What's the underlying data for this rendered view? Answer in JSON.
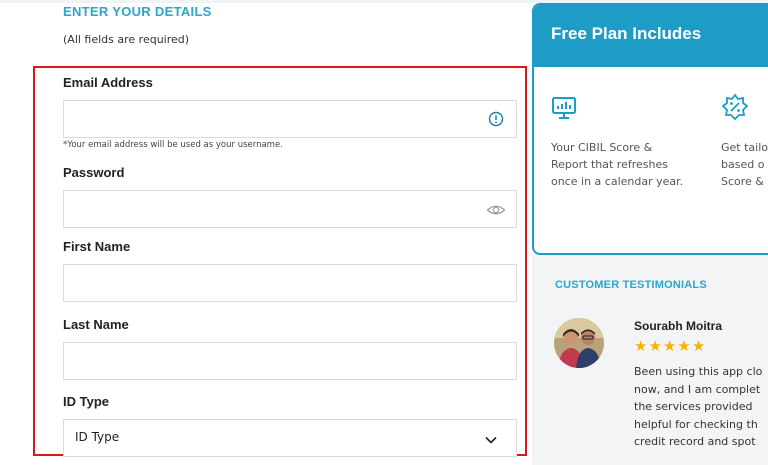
{
  "form": {
    "heading": "ENTER YOUR DETAILS",
    "subheading": "(All fields are required)",
    "email": {
      "label": "Email Address",
      "value": "",
      "hint": "*Your email address will be used as your username.",
      "icon": "info-icon"
    },
    "password": {
      "label": "Password",
      "value": "",
      "icon": "eye-icon"
    },
    "first_name": {
      "label": "First Name",
      "value": ""
    },
    "last_name": {
      "label": "Last Name",
      "value": ""
    },
    "id_type": {
      "label": "ID Type",
      "selected": "ID Type",
      "icon": "chevron-down-icon"
    }
  },
  "plan": {
    "title": "Free Plan Includes",
    "features": [
      {
        "icon": "score-monitor-icon",
        "text": "Your CIBIL Score &\nReport that refreshes\nonce in a calendar year."
      },
      {
        "icon": "offer-badge-icon",
        "text": "Get tailo\nbased o\nScore &"
      }
    ]
  },
  "testimonials": {
    "heading": "CUSTOMER TESTIMONIALS",
    "items": [
      {
        "name": "Sourabh Moitra",
        "rating": 5,
        "text": "Been using this app clo\nnow, and I am complet\nthe services provided\nhelpful for checking th\ncredit record and spot"
      }
    ]
  },
  "colors": {
    "accent": "#1d9cc6",
    "heading": "#2aa7c9",
    "highlight_border": "#d81919",
    "star": "#f5b400"
  }
}
